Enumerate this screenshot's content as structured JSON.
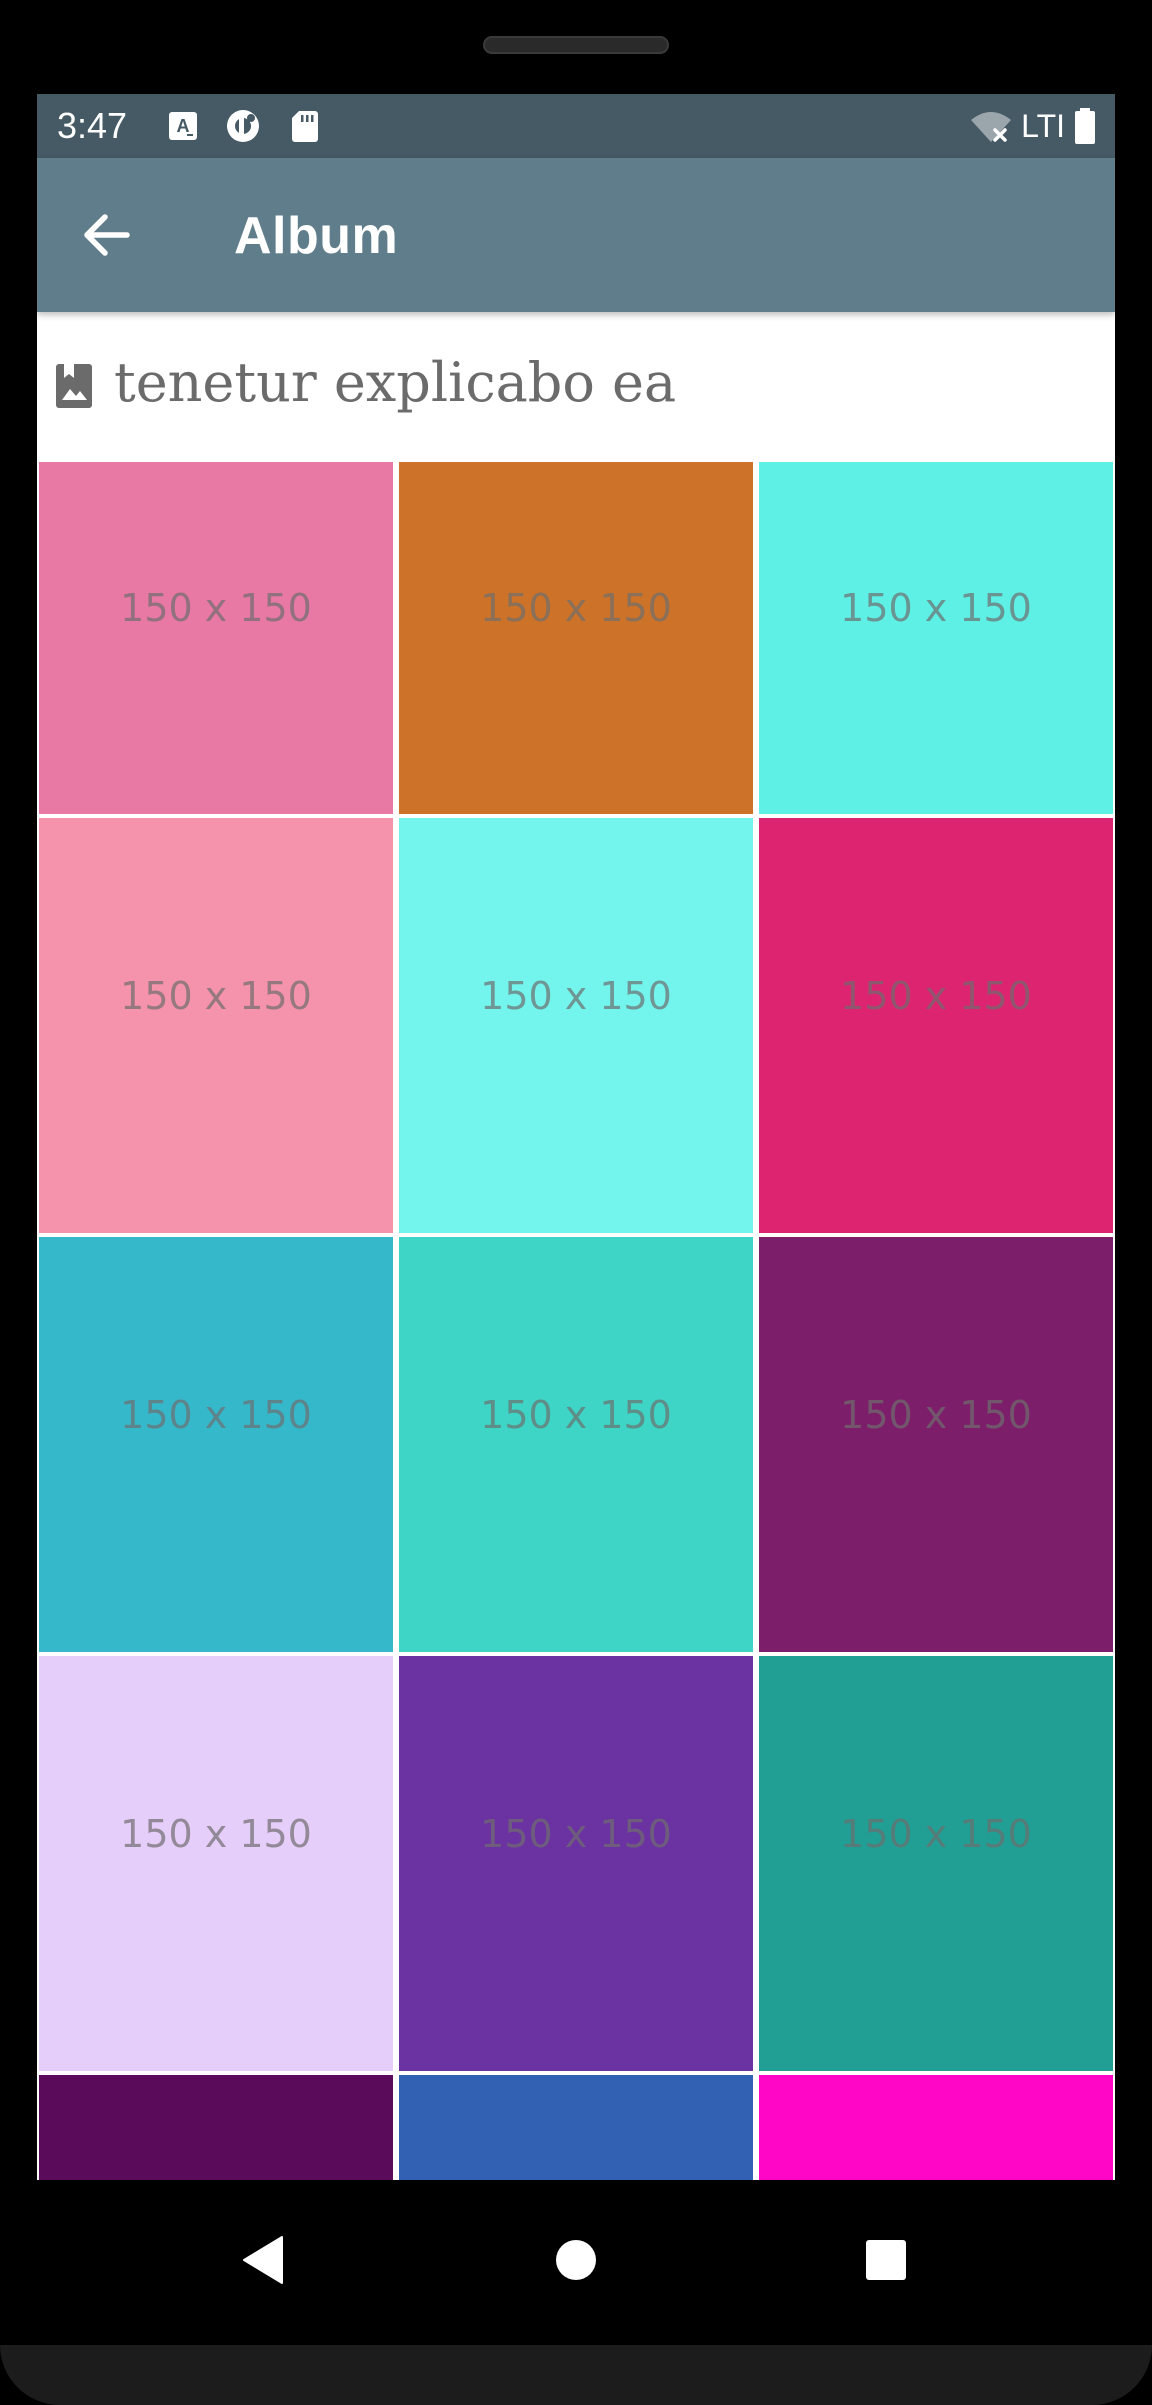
{
  "status_bar": {
    "time": "3:47",
    "icons": [
      "font-download-icon",
      "data-saver-icon",
      "sd-card-icon"
    ],
    "network_label": "LTI",
    "right_icons": [
      "wifi-off-icon",
      "battery-full-icon"
    ]
  },
  "app_bar": {
    "back_icon": "arrow-back-icon",
    "title": "Album"
  },
  "album": {
    "icon": "photo-album-icon",
    "title": "tenetur explicabo ea"
  },
  "photos": [
    {
      "label": "150 x 150",
      "color": "#e878a4"
    },
    {
      "label": "150 x 150",
      "color": "#cd7229"
    },
    {
      "label": "150 x 150",
      "color": "#5eefe5"
    },
    {
      "label": "150 x 150",
      "color": "#f693ac"
    },
    {
      "label": "150 x 150",
      "color": "#73f5ed"
    },
    {
      "label": "150 x 150",
      "color": "#dc2471"
    },
    {
      "label": "150 x 150",
      "color": "#36b8cb"
    },
    {
      "label": "150 x 150",
      "color": "#3ed5c6"
    },
    {
      "label": "150 x 150",
      "color": "#7c1e6a"
    },
    {
      "label": "150 x 150",
      "color": "#e6cefa"
    },
    {
      "label": "150 x 150",
      "color": "#6b32a1"
    },
    {
      "label": "150 x 150",
      "color": "#219f95"
    },
    {
      "label": "",
      "color": "#5a0c5a"
    },
    {
      "label": "",
      "color": "#3260b2"
    },
    {
      "label": "",
      "color": "#ff05c6"
    }
  ],
  "nav_bar": {
    "buttons": [
      "back-triangle-icon",
      "home-circle-icon",
      "recents-square-icon"
    ]
  }
}
